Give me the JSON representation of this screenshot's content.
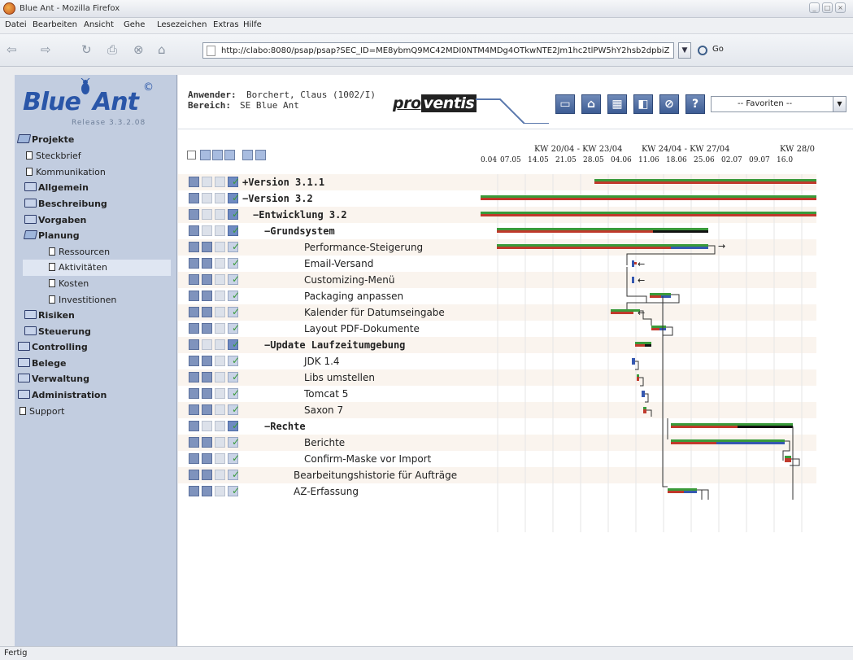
{
  "window": {
    "title": "Blue Ant - Mozilla Firefox"
  },
  "menu": [
    "Datei",
    "Bearbeiten",
    "Ansicht",
    "Gehe",
    "Lesezeichen",
    "Extras",
    "Hilfe"
  ],
  "url": "http://clabo:8080/psap/psap?SEC_ID=ME8ybmQ9MC42MDI0NTM4MDg4OTkwNTE2Jm1hc2tlPW5hY2hsb2dpbiZl",
  "go_label": "Go",
  "status": "Fertig",
  "logo": {
    "release": "Release 3.3.2.08",
    "copyright": "©",
    "text_blue": "Blue",
    "text_ant": "Ant"
  },
  "header": {
    "anwender_label": "Anwender:",
    "anwender_value": "Borchert, Claus (1002/I)",
    "bereich_label": "Bereich:",
    "bereich_value": "SE Blue Ant",
    "brand_pro": "pro",
    "brand_ventis": "ventis",
    "favoriten": "-- Favoriten --"
  },
  "nav": [
    {
      "label": "Projekte",
      "type": "folder-open",
      "bold": true
    },
    {
      "label": "Steckbrief",
      "type": "doc"
    },
    {
      "label": "Kommunikation",
      "type": "doc"
    },
    {
      "label": "Allgemein",
      "type": "folder",
      "bold": true
    },
    {
      "label": "Beschreibung",
      "type": "folder",
      "bold": true
    },
    {
      "label": "Vorgaben",
      "type": "folder",
      "bold": true
    },
    {
      "label": "Planung",
      "type": "folder-open",
      "bold": true
    },
    {
      "label": "Ressourcen",
      "type": "doc"
    },
    {
      "label": "Aktivitäten",
      "type": "doc",
      "selected": true
    },
    {
      "label": "Kosten",
      "type": "doc"
    },
    {
      "label": "Investitionen",
      "type": "doc"
    },
    {
      "label": "Risiken",
      "type": "folder",
      "bold": true
    },
    {
      "label": "Steuerung",
      "type": "folder",
      "bold": true
    },
    {
      "label": "Controlling",
      "type": "folder",
      "bold": true
    },
    {
      "label": "Belege",
      "type": "folder",
      "bold": true
    },
    {
      "label": "Verwaltung",
      "type": "folder",
      "bold": true
    },
    {
      "label": "Administration",
      "type": "folder",
      "bold": true
    },
    {
      "label": "Support",
      "type": "doc"
    }
  ],
  "gantt_header": {
    "weeks": [
      "KW 20/04 - KW 23/04",
      "KW 24/04 - KW 27/04",
      "KW 28/0"
    ],
    "dates": [
      "0.04",
      "07.05",
      "14.05",
      "21.05",
      "28.05",
      "04.06",
      "11.06",
      "18.06",
      "25.06",
      "02.07",
      "09.07",
      "16.0"
    ]
  },
  "rows": [
    {
      "label": "+Version 3.1.1",
      "bold": true
    },
    {
      "label": "−Version 3.2",
      "bold": true
    },
    {
      "label": "−Entwicklung 3.2",
      "bold": true
    },
    {
      "label": "−Grundsystem",
      "bold": true
    },
    {
      "label": "Performance-Steigerung"
    },
    {
      "label": "Email-Versand"
    },
    {
      "label": "Customizing-Menü"
    },
    {
      "label": "Packaging anpassen"
    },
    {
      "label": "Kalender für Datumseingabe"
    },
    {
      "label": "Layout PDF-Dokumente"
    },
    {
      "label": "−Update Laufzeitumgebung",
      "bold": true
    },
    {
      "label": "JDK 1.4"
    },
    {
      "label": "Libs umstellen"
    },
    {
      "label": "Tomcat 5"
    },
    {
      "label": "Saxon 7"
    },
    {
      "label": "−Rechte",
      "bold": true
    },
    {
      "label": "Berichte"
    },
    {
      "label": "Confirm-Maske vor Import"
    },
    {
      "label": "Bearbeitungshistorie für Aufträge"
    },
    {
      "label": "AZ-Erfassung"
    }
  ],
  "colors": {
    "plan": "#3a9a3a",
    "actual": "#c0392b",
    "progress": "#3558b0",
    "done": "#111111",
    "sidebar": "#c2cde0"
  }
}
